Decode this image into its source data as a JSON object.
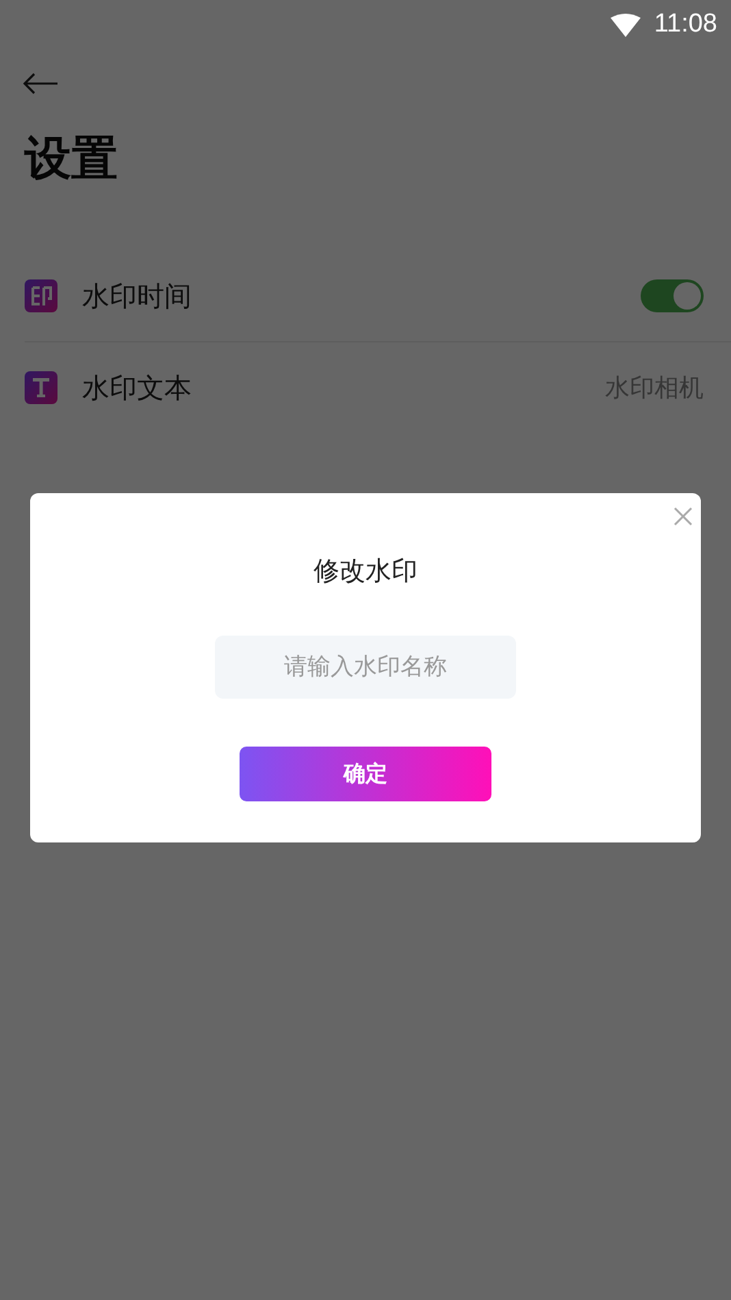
{
  "status_bar": {
    "time": "11:08"
  },
  "header": {
    "title": "设置"
  },
  "settings": [
    {
      "kind": "toggle",
      "label": "水印时间",
      "on": true
    },
    {
      "kind": "value",
      "label": "水印文本",
      "value": "水印相机"
    }
  ],
  "dialog": {
    "title": "修改水印",
    "input": {
      "placeholder": "请输入水印名称"
    },
    "confirm": "确定"
  }
}
